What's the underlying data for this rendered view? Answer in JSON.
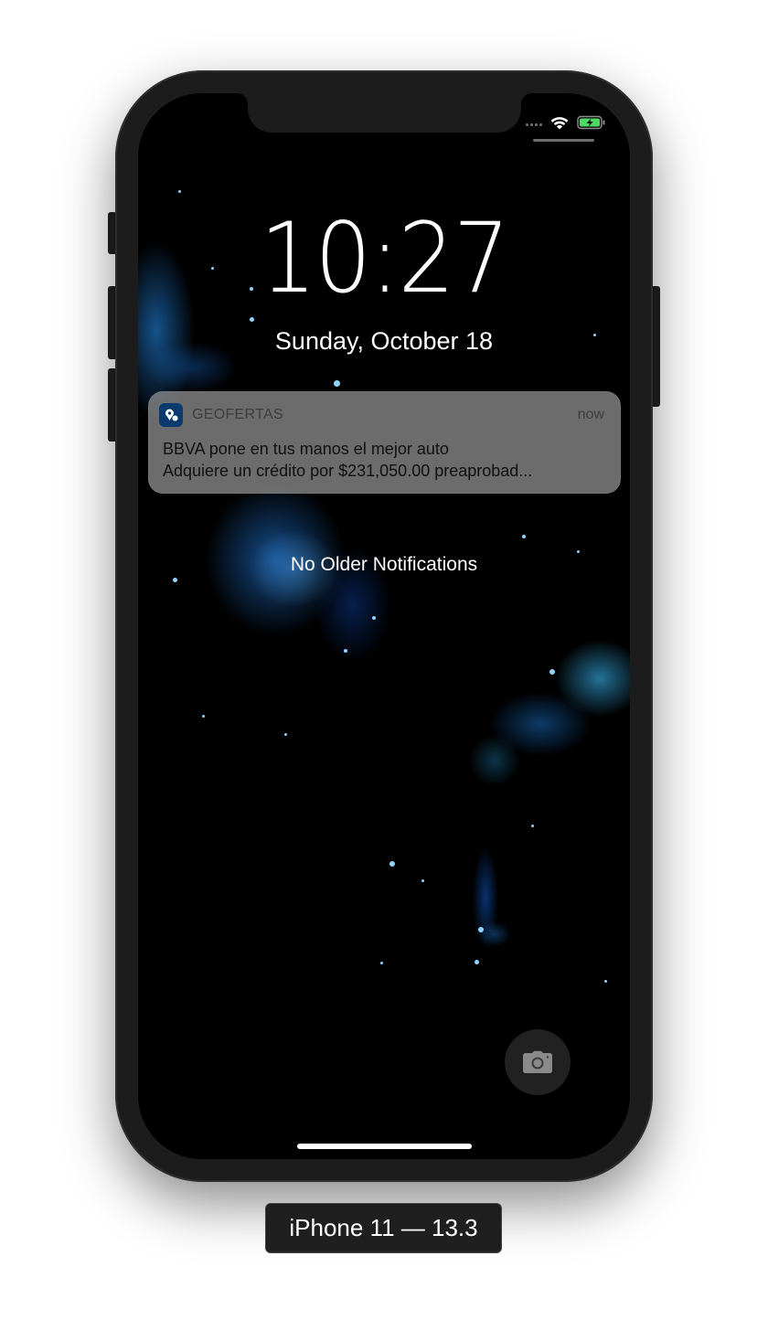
{
  "lock_screen": {
    "time": "10:27",
    "date": "Sunday, October 18"
  },
  "status_bar": {
    "wifi_icon": "wifi-icon",
    "battery_icon": "battery-charging-icon",
    "battery_color": "#4cd964"
  },
  "notification": {
    "app_name": "GEOFERTAS",
    "time": "now",
    "title": "BBVA pone en tus manos el mejor auto",
    "body": "Adquiere un crédito por $231,050.00 preaprobad...",
    "icon": "app-logo-icon"
  },
  "no_older_notifications": "No Older Notifications",
  "camera_icon": "camera-icon",
  "device_label": "iPhone 11 — 13.3"
}
